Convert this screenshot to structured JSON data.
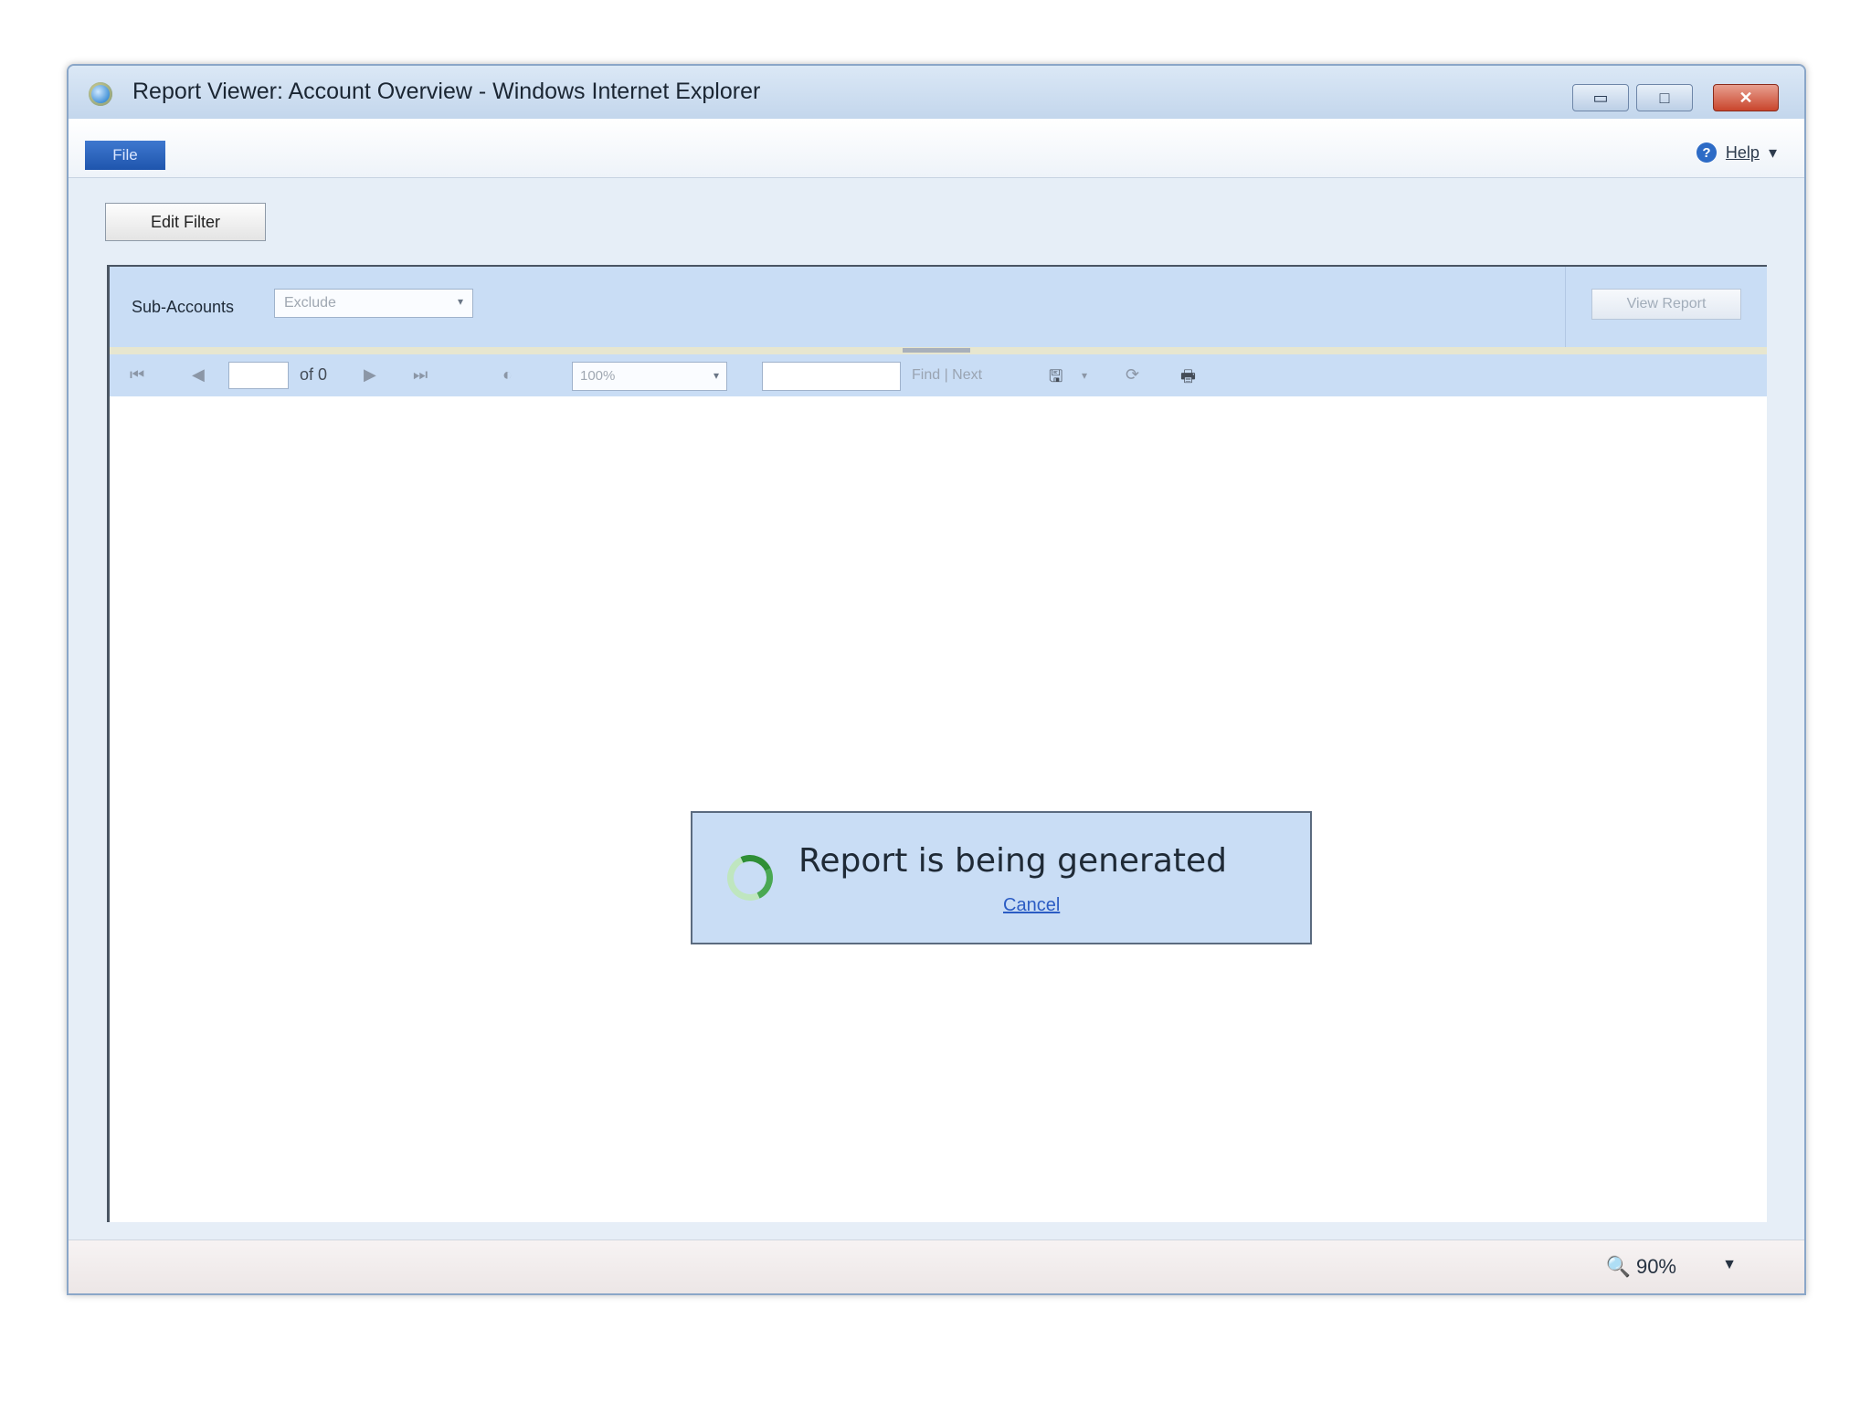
{
  "window": {
    "title": "Report Viewer: Account Overview - Windows Internet Explorer",
    "minimize_glyph": "▭",
    "maximize_glyph": "□",
    "close_glyph": "✕"
  },
  "menubar": {
    "file_label": "File",
    "help_label": "Help",
    "help_icon": "?",
    "help_chevron": "▾"
  },
  "toolbar": {
    "edit_filter_label": "Edit Filter"
  },
  "parameters": {
    "subaccounts_label": "Sub-Accounts",
    "subaccounts_value": "Exclude",
    "view_report_label": "View Report",
    "dropdown_arrow": "▾"
  },
  "report_toolbar": {
    "first_page_icon": "⏮",
    "prev_page_icon": "◀",
    "page_value": "",
    "of_pages": "of 0",
    "next_page_icon": "▶",
    "last_page_icon": "⏭",
    "back_icon": "◐",
    "zoom_value": "100%",
    "find_value": "",
    "find_next_label": "Find | Next",
    "export_icon": "🖫",
    "export_chevron": "▾",
    "refresh_icon": "⟳",
    "print_icon": "🖶"
  },
  "loading": {
    "message": "Report is being generated",
    "cancel_label": "Cancel"
  },
  "statusbar": {
    "zoom_icon": "🔍",
    "zoom_level": "90%",
    "zoom_chevron": "▼"
  },
  "colors": {
    "panel_blue": "#c9ddf5",
    "file_menu_blue": "#1f55ad",
    "close_red": "#c9452c"
  }
}
